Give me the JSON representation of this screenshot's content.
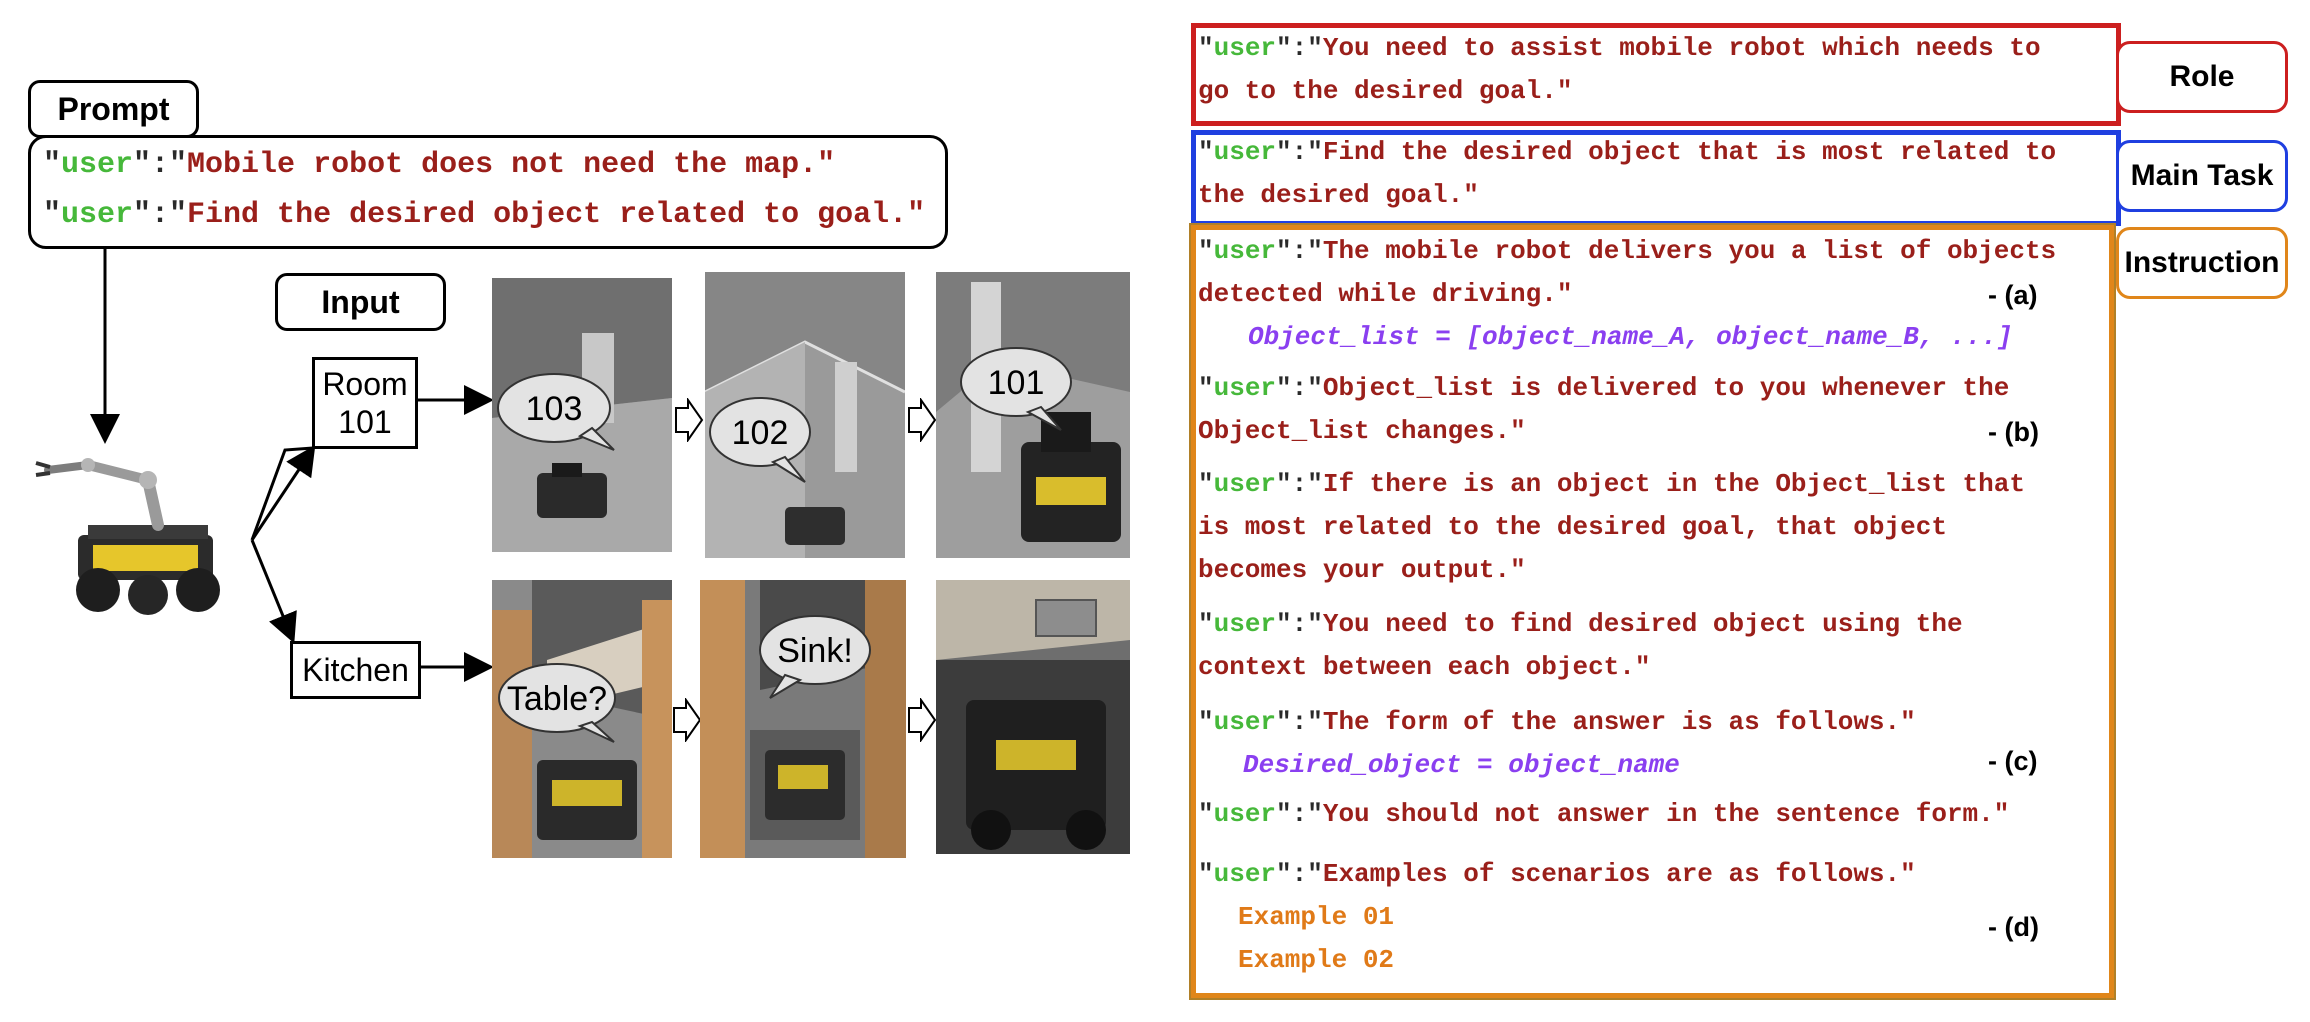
{
  "prompt_section": {
    "tag": "Prompt",
    "lines": [
      {
        "role": "user",
        "text": "Mobile robot does not need the map."
      },
      {
        "role": "user",
        "text": "Find the desired object related to goal."
      }
    ]
  },
  "input_section": {
    "tag": "Input",
    "branches": [
      {
        "label_line1": "Room",
        "label_line2": "101",
        "bubbles": [
          "103",
          "102",
          "101"
        ]
      },
      {
        "label_line1": "Kitchen",
        "label_line2": "",
        "bubbles": [
          "Table?",
          "Sink!",
          ""
        ]
      }
    ]
  },
  "right_panel": {
    "role": {
      "label": "Role",
      "color": "#cc1f1f",
      "lines": [
        {
          "role": "user",
          "text": "You need to assist mobile robot which needs to",
          "open": true,
          "close": false
        },
        {
          "role": "",
          "text": "go to the desired goal.",
          "open": false,
          "close": true
        }
      ]
    },
    "main_task": {
      "label": "Main Task",
      "color": "#1f3fe0",
      "lines": [
        {
          "role": "user",
          "text": "Find the desired object that is most related to",
          "open": true,
          "close": false
        },
        {
          "role": "",
          "text": "the desired goal.",
          "open": false,
          "close": true
        }
      ]
    },
    "instruction": {
      "label": "Instruction",
      "color": "#e0861a",
      "blocks": [
        {
          "lines": [
            "The mobile robot delivers you a list of objects",
            "detected while driving."
          ],
          "code": "Object_list = [object_name_A, object_name_B, ...]",
          "marker": "- (a)"
        },
        {
          "lines": [
            "Object_list is delivered to you whenever the",
            "Object_list changes."
          ],
          "marker": "- (b)"
        },
        {
          "lines": [
            "If there is an object in the Object_list that",
            "is most related to the desired goal, that object",
            "becomes your output."
          ]
        },
        {
          "lines": [
            "You need to find desired object using the",
            "context between each object."
          ]
        },
        {
          "lines": [
            "The form of the answer is as follows."
          ],
          "code": "Desired_object = object_name",
          "marker": "- (c)"
        },
        {
          "lines": [
            "You should not answer in the sentence form."
          ]
        },
        {
          "lines": [
            "Examples of scenarios are as follows."
          ],
          "examples": [
            "Example 01",
            "Example 02"
          ],
          "marker": "- (d)"
        }
      ]
    }
  }
}
